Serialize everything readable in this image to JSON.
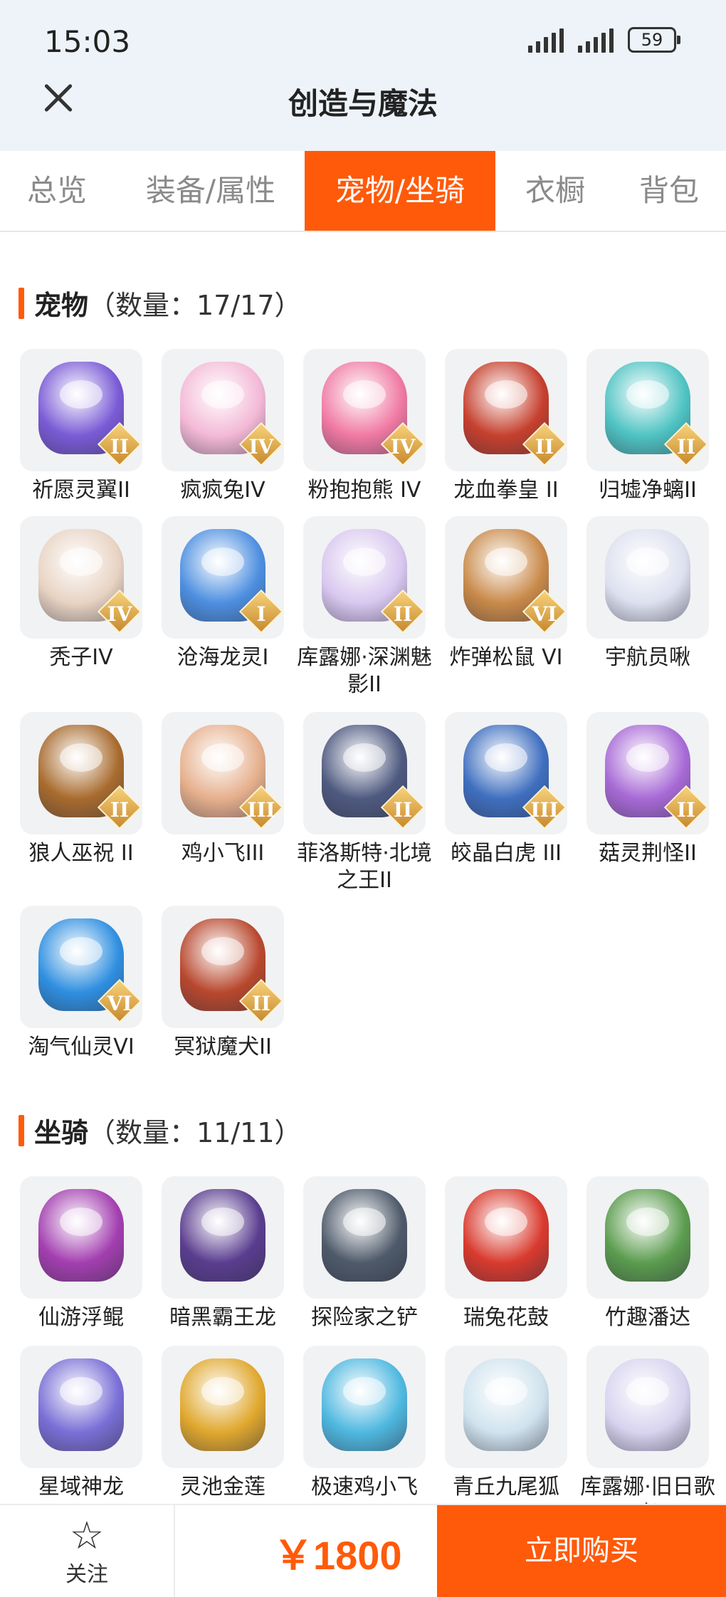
{
  "status": {
    "time": "15:03",
    "battery": "59"
  },
  "header": {
    "title": "创造与魔法"
  },
  "tabs": [
    "总览",
    "装备/属性",
    "宠物/坐骑",
    "衣橱",
    "背包"
  ],
  "active_tab": "宠物/坐骑",
  "pets": {
    "title": "宠物",
    "count": "（数量：17/17）",
    "items": [
      {
        "name": "祈愿灵翼II",
        "tier": "II",
        "color": "#7a5bd6"
      },
      {
        "name": "疯疯兔IV",
        "tier": "IV",
        "color": "#f3b9d6"
      },
      {
        "name": "粉抱抱熊 IV",
        "tier": "IV",
        "color": "#f07aa3"
      },
      {
        "name": "龙血拳皇 II",
        "tier": "II",
        "color": "#c6402e"
      },
      {
        "name": "归墟净螭II",
        "tier": "II",
        "color": "#4fc3c3"
      },
      {
        "name": "秃子IV",
        "tier": "IV",
        "color": "#e8d3c3"
      },
      {
        "name": "沧海龙灵I",
        "tier": "I",
        "color": "#4d8fe0"
      },
      {
        "name": "库露娜·深渊魅影II",
        "tier": "II",
        "color": "#d8c7ef"
      },
      {
        "name": "炸弹松鼠 VI",
        "tier": "VI",
        "color": "#c98a4a"
      },
      {
        "name": "宇航员啾",
        "tier": "",
        "color": "#dde0ef"
      },
      {
        "name": "狼人巫祝 II",
        "tier": "II",
        "color": "#a86b2e"
      },
      {
        "name": "鸡小飞III",
        "tier": "III",
        "color": "#e6b08d"
      },
      {
        "name": "菲洛斯特·北境之王II",
        "tier": "II",
        "color": "#4f5a80"
      },
      {
        "name": "皎晶白虎 III",
        "tier": "III",
        "color": "#3f6fbf"
      },
      {
        "name": "菇灵荆怪II",
        "tier": "II",
        "color": "#a86ad6"
      },
      {
        "name": "淘气仙灵VI",
        "tier": "VI",
        "color": "#2f8fe0"
      },
      {
        "name": "冥狱魔犬II",
        "tier": "II",
        "color": "#b8482e"
      }
    ]
  },
  "mounts": {
    "title": "坐骑",
    "count": "（数量：11/11）",
    "items": [
      {
        "name": "仙游浮鲲",
        "color": "#a33fb0"
      },
      {
        "name": "暗黑霸王龙",
        "color": "#5a3d8f"
      },
      {
        "name": "探险家之铲",
        "color": "#4e5a6a"
      },
      {
        "name": "瑞兔花鼓",
        "color": "#d93a2e"
      },
      {
        "name": "竹趣潘达",
        "color": "#5b9c4e"
      },
      {
        "name": "星域神龙",
        "color": "#7a6fd6"
      },
      {
        "name": "灵池金莲",
        "color": "#e0a82e"
      },
      {
        "name": "极速鸡小飞",
        "color": "#4fb8e0"
      },
      {
        "name": "青丘九尾狐",
        "color": "#cfe3ee"
      },
      {
        "name": "库露娜·旧日歌者",
        "color": "#d8d3ef"
      }
    ]
  },
  "footer": {
    "follow_icon": "star-icon",
    "follow_label": "关注",
    "price": "￥1800",
    "buy_label": "立即购买"
  }
}
